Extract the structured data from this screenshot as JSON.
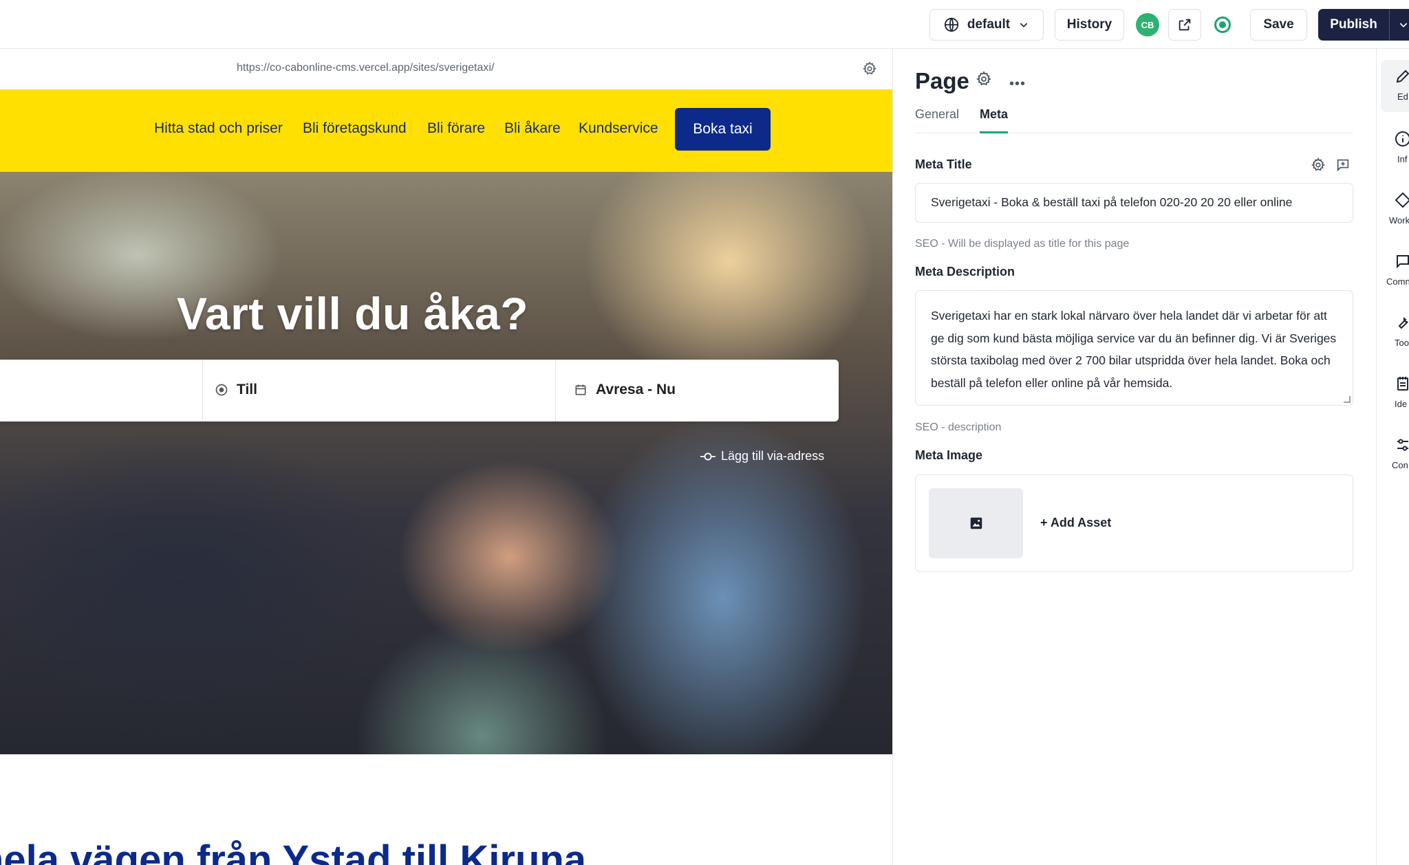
{
  "topbar": {
    "locale": "default",
    "history": "History",
    "avatar_initials": "CB",
    "save": "Save",
    "publish": "Publish"
  },
  "preview": {
    "url": "https://co-cabonline-cms.vercel.app/sites/sverigetaxi/",
    "nav": [
      "Hitta stad och priser",
      "Bli företagskund",
      "Bli förare",
      "Bli åkare",
      "Kundservice"
    ],
    "cta": "Boka taxi",
    "hero_title": "Vart vill du åka?",
    "to_label": "Till",
    "depart_label": "Avresa - Nu",
    "via_label": "Lägg till via-adress",
    "section_heading": "hela vägen från Ystad till Kiruna"
  },
  "panel": {
    "title": "Page",
    "tabs": [
      "General",
      "Meta"
    ],
    "active_tab": "Meta",
    "meta_title_label": "Meta Title",
    "meta_title_value": "Sverigetaxi - Boka & beställ taxi på telefon 020-20 20 20 eller online",
    "meta_title_hint": "SEO - Will be displayed as title for this page",
    "meta_desc_label": "Meta Description",
    "meta_desc_value": "Sverigetaxi har en stark lokal närvaro över hela landet där vi arbetar för att ge dig som kund bästa möjliga service var du än befinner dig. Vi är Sveriges största taxibolag med över 2 700 bilar utspridda över hela landet. Boka och beställ på telefon eller online på vår hemsida.",
    "meta_desc_hint": "SEO - description",
    "meta_image_label": "Meta Image",
    "add_asset": "+ Add Asset"
  },
  "rail": [
    "Ed",
    "Inf",
    "Work",
    "Comn",
    "Too",
    "Ide",
    "Con"
  ],
  "colors": {
    "nav_yellow": "#ffe000",
    "brand_blue": "#0c2a8a",
    "publish_bg": "#1b2242",
    "accent_green": "#1aa37a",
    "avatar_green": "#2fb171"
  }
}
